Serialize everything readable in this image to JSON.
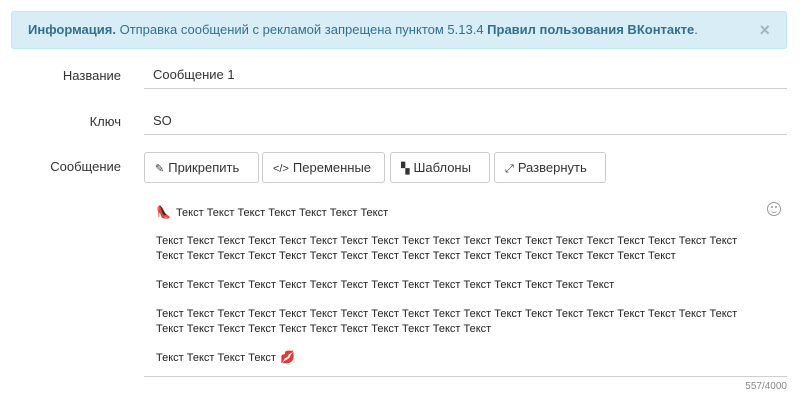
{
  "alert": {
    "label": "Информация.",
    "text": " Отправка сообщений с рекламой запрещена пунктом 5.13.4 ",
    "link": "Правил пользования ВКонтакте",
    "end": ".",
    "close": "×"
  },
  "form": {
    "name_label": "Название",
    "name_value": "Сообщение 1",
    "key_label": "Ключ",
    "key_value": "SO",
    "message_label": "Сообщение"
  },
  "toolbar": {
    "attach": "Прикрепить",
    "variables": "Переменные",
    "templates": "Шаблоны",
    "expand": "Развернуть"
  },
  "icons": {
    "attach": "paperclip-icon",
    "variables": "code-icon",
    "templates": "copy-icon",
    "expand": "expand-icon",
    "emoji": "smiley-icon"
  },
  "message": {
    "line1": "Текст Текст Текст Текст Текст Текст Текст",
    "para2": "Текст Текст Текст Текст Текст Текст Текст Текст Текст Текст Текст Текст Текст Текст Текст Текст Текст Текст Текст Текст Текст Текст Текст Текст Текст Текст Текст Текст Текст Текст Текст Текст Текст Текст Текст Текст",
    "para3": "Текст Текст Текст Текст Текст Текст Текст Текст Текст Текст Текст Текст Текст Текст Текст",
    "para4": "Текст Текст Текст Текст Текст Текст Текст Текст Текст Текст Текст Текст Текст Текст Текст Текст Текст Текст Текст Текст Текст Текст Текст Текст Текст Текст Текст Текст Текст Текст",
    "para5": "Текст Текст Текст Текст"
  },
  "counter": "557/4000"
}
